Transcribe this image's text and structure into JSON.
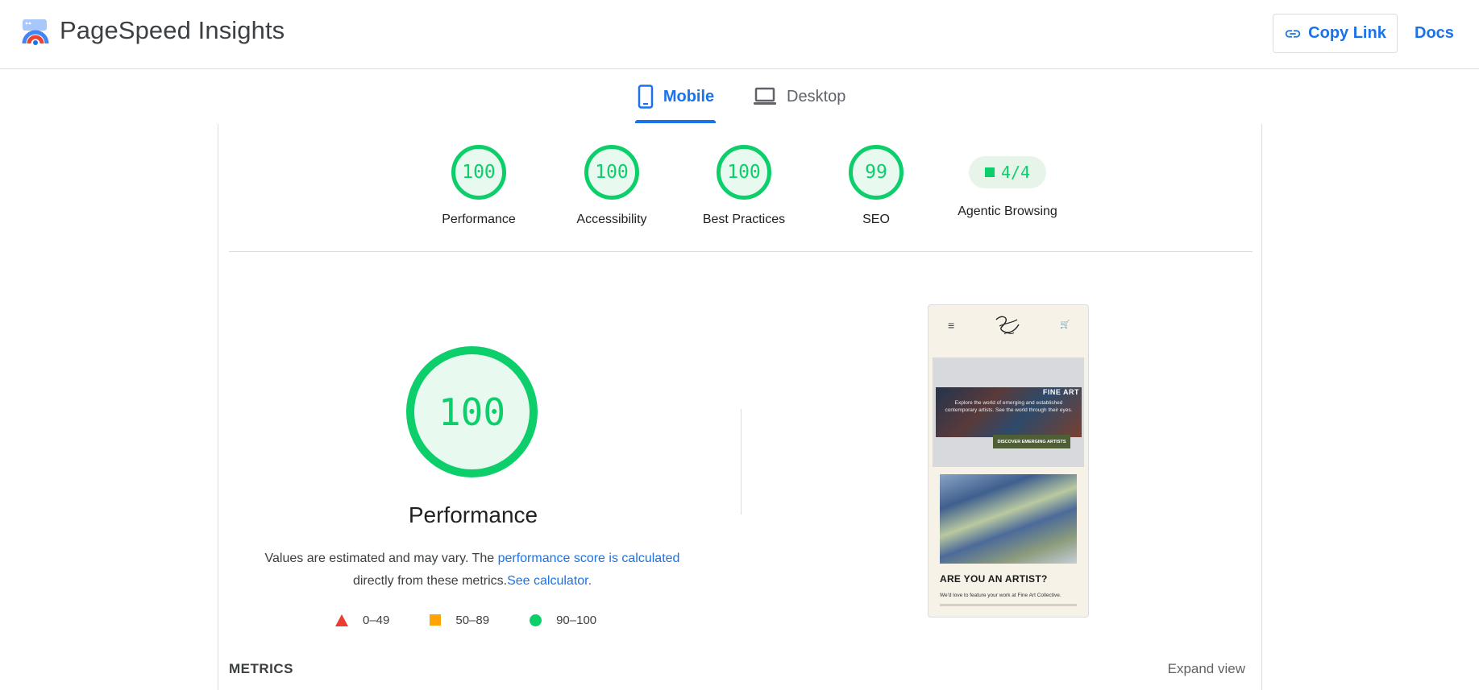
{
  "header": {
    "app_title": "PageSpeed Insights",
    "copy_link_label": "Copy Link",
    "docs_label": "Docs"
  },
  "tabs": [
    {
      "label": "Mobile",
      "active": true
    },
    {
      "label": "Desktop",
      "active": false
    }
  ],
  "scores": [
    {
      "value": "100",
      "label": "Performance"
    },
    {
      "value": "100",
      "label": "Accessibility"
    },
    {
      "value": "100",
      "label": "Best Practices"
    },
    {
      "value": "99",
      "label": "SEO"
    }
  ],
  "agentic": {
    "value": "4/4",
    "label": "Agentic Browsing"
  },
  "performance": {
    "score": "100",
    "title": "Performance",
    "desc_prefix": "Values are estimated and may vary. The ",
    "desc_link": "performance score is calculated",
    "desc_middle": " directly from these metrics.",
    "desc_calc_link": "See calculator."
  },
  "legend": [
    {
      "range": "0–49",
      "color": "#eb3c32"
    },
    {
      "range": "50–89",
      "color": "#ffa400"
    },
    {
      "range": "90–100",
      "color": "#0cce6b"
    }
  ],
  "preview": {
    "hero_title": "FINE ART",
    "hero_text": "Explore the world of emerging and established contemporary artists. See the world through their eyes.",
    "hero_button": "DISCOVER EMERGING ARTISTS",
    "heading": "ARE YOU AN ARTIST?",
    "paragraph": "We'd love to feature your work at Fine Art Collective."
  },
  "metrics": {
    "title": "METRICS",
    "expand_label": "Expand view"
  },
  "colors": {
    "accent": "#1a73e8",
    "pass": "#0cce6b",
    "average": "#ffa400",
    "fail": "#eb3c32"
  }
}
